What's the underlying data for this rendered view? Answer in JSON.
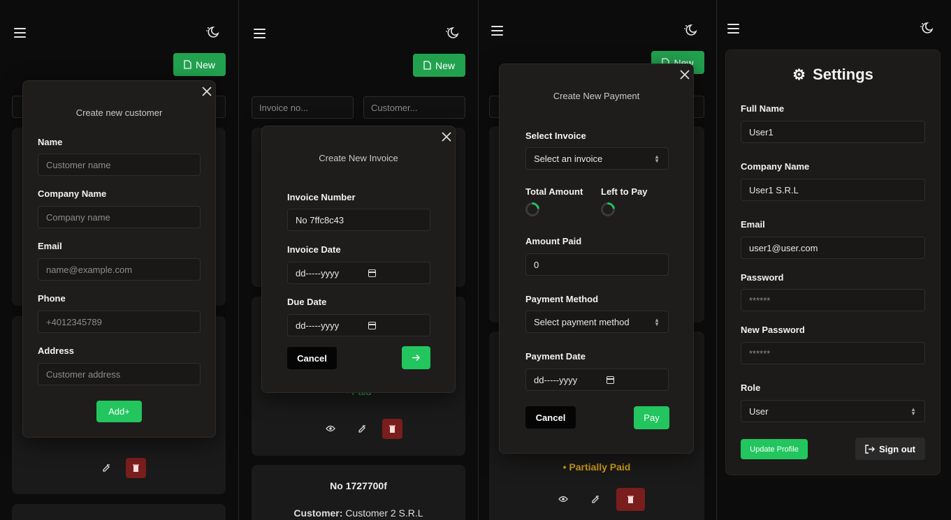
{
  "colors": {
    "accent_green": "#22c55e",
    "new_button": "#22a24f",
    "danger": "#7a1d1d",
    "partially_paid": "#d4a017",
    "paid": "#22c55e"
  },
  "customers_panel": {
    "new_button_label": "New",
    "modal": {
      "title": "Create new customer",
      "fields": [
        {
          "label": "Name",
          "placeholder": "Customer name"
        },
        {
          "label": "Company Name",
          "placeholder": "Company name"
        },
        {
          "label": "Email",
          "placeholder": "name@example.com"
        },
        {
          "label": "Phone",
          "placeholder": "+4012345789"
        },
        {
          "label": "Address",
          "placeholder": "Customer address"
        }
      ],
      "submit_label": "Add+"
    }
  },
  "invoices_panel": {
    "new_button_label": "New",
    "filters": {
      "invoice_placeholder": "Invoice no...",
      "customer_placeholder": "Customer..."
    },
    "modal": {
      "title": "Create New Invoice",
      "invoice_number_label": "Invoice Number",
      "invoice_number_value": "No 7ffc8c43",
      "invoice_date_label": "Invoice Date",
      "invoice_date_value": "dd-----yyyy",
      "due_date_label": "Due Date",
      "due_date_value": "dd-----yyyy",
      "cancel_label": "Cancel"
    },
    "card_status": "• Paid",
    "card2": {
      "number": "No 1727700f",
      "customer_label": "Customer:",
      "customer_value": "Customer 2 S.R.L"
    }
  },
  "payments_panel": {
    "new_button_label": "New",
    "modal": {
      "title": "Create New Payment",
      "select_invoice_label": "Select Invoice",
      "select_invoice_value": "Select an invoice",
      "total_amount_label": "Total Amount",
      "left_to_pay_label": "Left to Pay",
      "amount_paid_label": "Amount Paid",
      "amount_paid_value": "0",
      "payment_method_label": "Payment Method",
      "payment_method_value": "Select payment method",
      "payment_date_label": "Payment Date",
      "payment_date_value": "dd-----yyyy",
      "cancel_label": "Cancel",
      "pay_label": "Pay"
    },
    "card_status": "• Partially Paid"
  },
  "settings_panel": {
    "title": "Settings",
    "fields": [
      {
        "label": "Full Name",
        "value": "User1"
      },
      {
        "label": "Company Name",
        "value": "User1 S.R.L"
      },
      {
        "label": "Email",
        "value": "user1@user.com"
      },
      {
        "label": "Password",
        "value": "******"
      },
      {
        "label": "New Password",
        "value": "******"
      }
    ],
    "role_label": "Role",
    "role_value": "User",
    "update_label": "Update Profile",
    "signout_label": "Sign out"
  }
}
